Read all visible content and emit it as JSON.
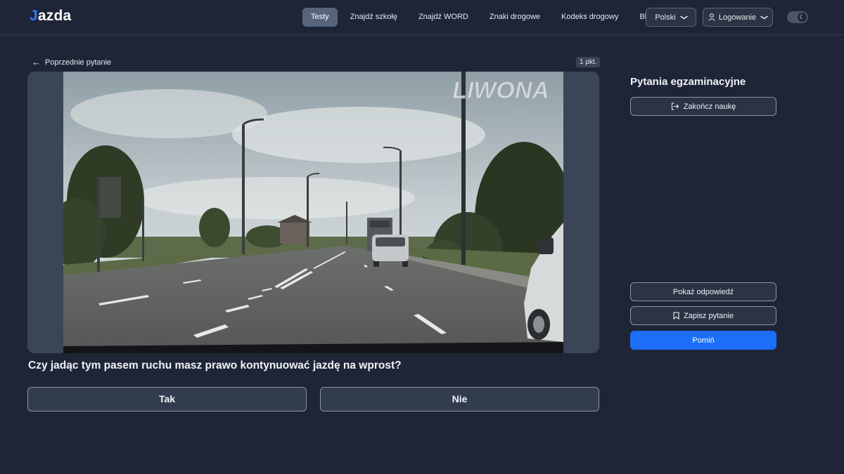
{
  "header": {
    "logo": {
      "mark": "J",
      "text": "azda"
    },
    "nav": [
      {
        "label": "Testy",
        "active": true
      },
      {
        "label": "Znajdź szkołę",
        "active": false
      },
      {
        "label": "Znajdź WORD",
        "active": false
      },
      {
        "label": "Znaki drogowe",
        "active": false
      },
      {
        "label": "Kodeks drogowy",
        "active": false
      },
      {
        "label": "Blog",
        "active": false
      }
    ],
    "language": "Polski",
    "login": "Logowanie",
    "theme_icon": "moon-icon"
  },
  "question": {
    "back_label": "Poprzednie pytanie",
    "points": "1 pkt.",
    "watermark": "LIWONA",
    "text": "Czy jadąc tym pasem ruchu masz prawo kontynuować jazdę na wprost?",
    "answers": [
      "Tak",
      "Nie"
    ]
  },
  "sidebar": {
    "title": "Pytania egzaminacyjne",
    "end_label": "Zakończ naukę",
    "show_answer_label": "Pokaż odpowiedź",
    "save_label": "Zapisz pytanie",
    "skip_label": "Pomiń"
  },
  "colors": {
    "background": "#1e2536",
    "accent": "#1b6ef5",
    "logo_accent": "#2f7bff"
  }
}
